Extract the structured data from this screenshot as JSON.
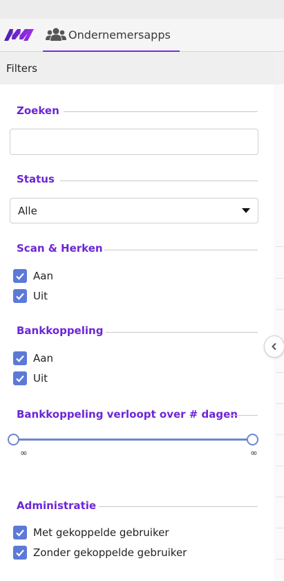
{
  "header": {
    "tab_label": "Ondernemersapps"
  },
  "filters_label": "Filters",
  "sections": {
    "zoeken": {
      "title": "Zoeken",
      "input_value": ""
    },
    "status": {
      "title": "Status",
      "selected": "Alle"
    },
    "scan": {
      "title": "Scan & Herken",
      "options": [
        "Aan",
        "Uit"
      ]
    },
    "bank": {
      "title": "Bankkoppeling",
      "options": [
        "Aan",
        "Uit"
      ]
    },
    "expires": {
      "title": "Bankkoppeling verloopt over # dagen",
      "min_label": "∞",
      "max_label": "∞"
    },
    "admin": {
      "title": "Administratie",
      "options": [
        "Met gekoppelde gebruiker",
        "Zonder gekoppelde gebruiker"
      ]
    }
  },
  "colors": {
    "accent": "#6d26d6",
    "checkbox": "#5b7ad8",
    "slider": "#6d86cc"
  }
}
